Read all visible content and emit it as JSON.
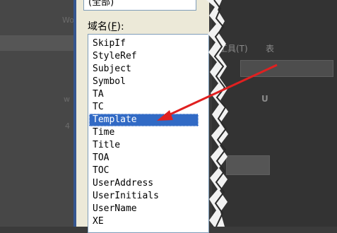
{
  "dialog": {
    "top_value": "(全部)",
    "field_label": "域名",
    "field_accel": "F",
    "field_label_rest": "):",
    "field_label_open": "(",
    "field_list": {
      "items": [
        "SkipIf",
        "StyleRef",
        "Subject",
        "Symbol",
        "TA",
        "TC",
        "Template",
        "Time",
        "Title",
        "TOA",
        "TOC",
        "UserAddress",
        "UserInitials",
        "UserName",
        "XE"
      ],
      "selected": "Template"
    }
  },
  "background": {
    "left_fragments": [
      "Wo",
      "w",
      "4"
    ],
    "right_fragments": [
      "工具(T)",
      "表",
      "U"
    ]
  },
  "annotation": {
    "arrow_color": "#e02020"
  }
}
